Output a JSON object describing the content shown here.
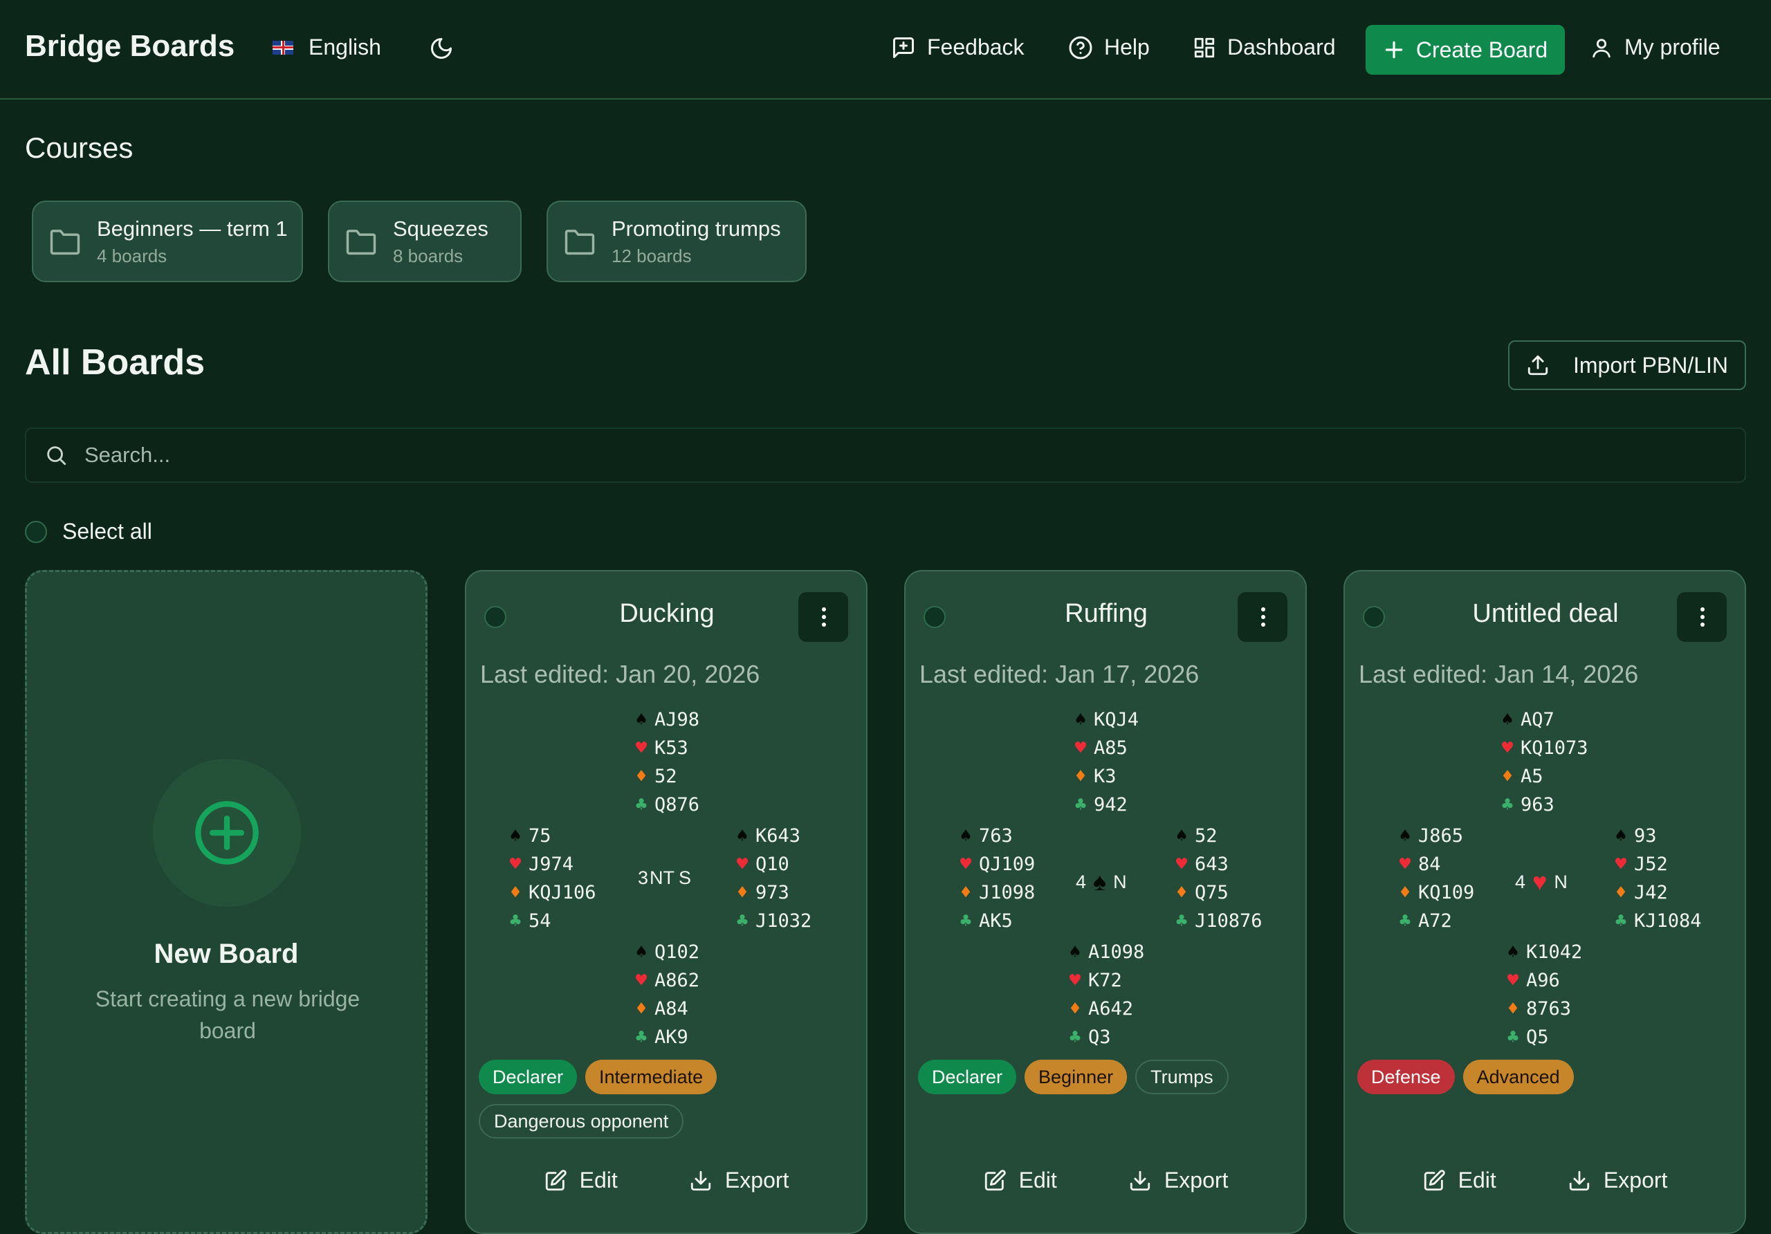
{
  "header": {
    "brand": "Bridge Boards",
    "language": "English",
    "nav": {
      "feedback": "Feedback",
      "help": "Help",
      "dashboard": "Dashboard",
      "create_board": "Create Board",
      "profile": "My profile"
    }
  },
  "courses": {
    "title": "Courses",
    "items": [
      {
        "name": "Beginners — term 1",
        "count": "4 boards"
      },
      {
        "name": "Squeezes",
        "count": "8 boards"
      },
      {
        "name": "Promoting trumps",
        "count": "12 boards"
      }
    ]
  },
  "boards": {
    "title": "All Boards",
    "import_label": "Import PBN/LIN",
    "search_placeholder": "Search...",
    "select_all": "Select all",
    "new_board": {
      "title": "New Board",
      "description": "Start creating a new bridge board"
    },
    "action_edit": "Edit",
    "action_export": "Export",
    "items": [
      {
        "title": "Ducking",
        "last_edited": "Last edited: Jan 20, 2026",
        "north": [
          "AJ98",
          "K53",
          "52",
          "Q876"
        ],
        "west": [
          "75",
          "J974",
          "KQJ106",
          "54"
        ],
        "east": [
          "K643",
          "Q10",
          "973",
          "J1032"
        ],
        "south": [
          "Q102",
          "A862",
          "A84",
          "AK9"
        ],
        "contract": {
          "level": "3",
          "strain": "NT",
          "declarer": "S"
        },
        "tags": [
          "Declarer",
          "Intermediate",
          "Dangerous opponent"
        ]
      },
      {
        "title": "Ruffing",
        "last_edited": "Last edited: Jan 17, 2026",
        "north": [
          "KQJ4",
          "A85",
          "K3",
          "942"
        ],
        "west": [
          "763",
          "QJ109",
          "J1098",
          "AK5"
        ],
        "east": [
          "52",
          "643",
          "Q75",
          "J10876"
        ],
        "south": [
          "A1098",
          "K72",
          "A642",
          "Q3"
        ],
        "contract": {
          "level": "4",
          "strain": "spade",
          "declarer": "N"
        },
        "tags": [
          "Declarer",
          "Beginner",
          "Trumps"
        ]
      },
      {
        "title": "Untitled deal",
        "last_edited": "Last edited: Jan 14, 2026",
        "north": [
          "AQ7",
          "KQ1073",
          "A5",
          "963"
        ],
        "west": [
          "J865",
          "84",
          "KQ109",
          "A72"
        ],
        "east": [
          "93",
          "J52",
          "J42",
          "KJ1084"
        ],
        "south": [
          "K1042",
          "A96",
          "8763",
          "Q5"
        ],
        "contract": {
          "level": "4",
          "strain": "heart",
          "declarer": "N"
        },
        "tags": [
          "Defense",
          "Advanced"
        ]
      }
    ]
  },
  "colors": {
    "background": "#0c2719",
    "card": "#244a38",
    "accent_green": "#0f8a4c",
    "tag_orange": "#c8862b",
    "tag_red": "#bf3138",
    "heart": "#ef2b37",
    "diamond": "#f47c15",
    "club": "#3bb06b",
    "spade": "#020a05"
  }
}
